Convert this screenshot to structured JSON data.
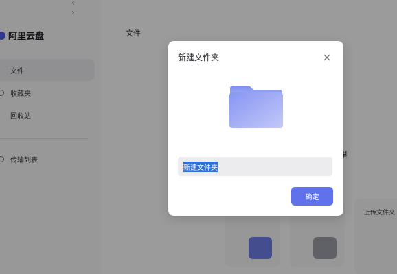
{
  "app": {
    "logo_text": "阿里云盘",
    "nav_arrows": "‹  ›"
  },
  "sidebar": {
    "items": [
      {
        "label": "文件",
        "active": true
      },
      {
        "label": "收藏夹",
        "active": false
      },
      {
        "label": "回收站",
        "active": false
      },
      {
        "label": "传输列表",
        "active": false
      }
    ]
  },
  "main": {
    "title": "文件",
    "partial_text": "里",
    "upload_card_label": "上传文件夹"
  },
  "dialog": {
    "title": "新建文件夹",
    "input_value": "新建文件夹",
    "confirm_label": "确定"
  },
  "colors": {
    "accent": "#6071ec",
    "folder_top": "#8b9cf5",
    "folder_bottom": "#b8c0f7"
  }
}
